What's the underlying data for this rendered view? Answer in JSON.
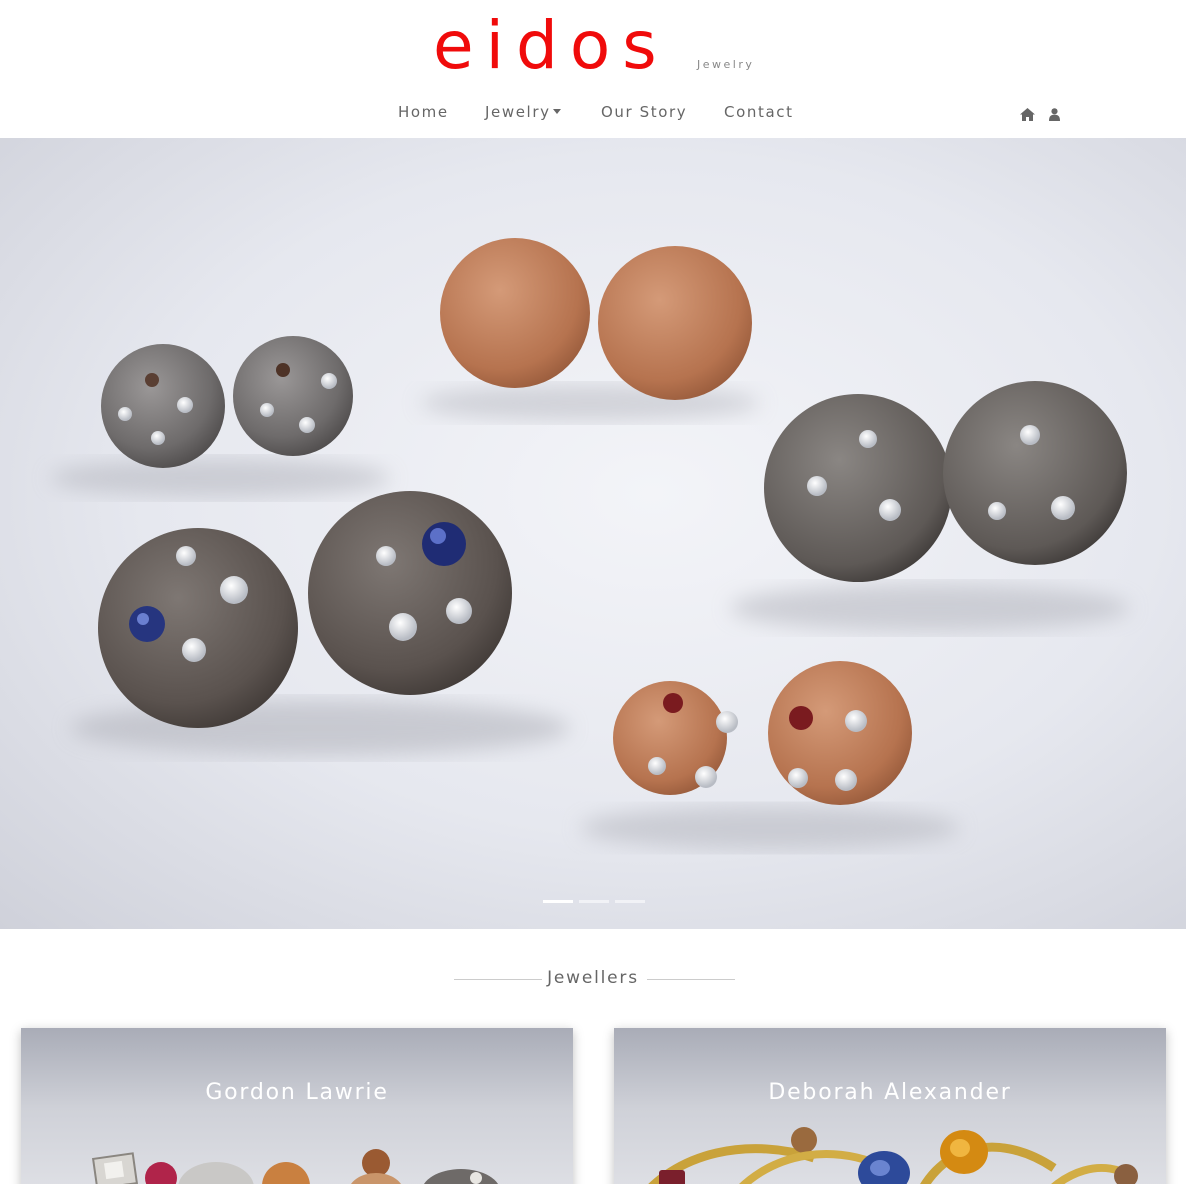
{
  "brand": {
    "name": "eidos",
    "tagline": "Jewelry",
    "color": "#f00b0b"
  },
  "nav": {
    "items": [
      {
        "label": "Home"
      },
      {
        "label": "Jewelry",
        "has_dropdown": true
      },
      {
        "label": "Our Story"
      },
      {
        "label": "Contact"
      }
    ],
    "icons": [
      "home-icon",
      "user-icon"
    ]
  },
  "carousel": {
    "slide_count": 3,
    "active_index": 0
  },
  "section": {
    "title": "Jewellers"
  },
  "jewellers": [
    {
      "name": "Gordon Lawrie"
    },
    {
      "name": "Deborah Alexander"
    }
  ]
}
